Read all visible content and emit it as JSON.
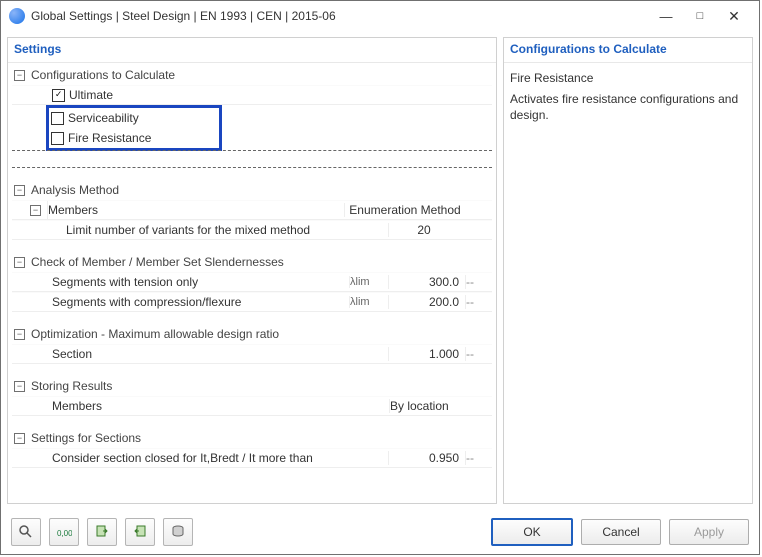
{
  "window": {
    "title": "Global Settings | Steel Design | EN 1993 | CEN | 2015-06"
  },
  "left": {
    "title": "Settings",
    "groups": {
      "config": {
        "title": "Configurations to Calculate",
        "items": {
          "ultimate": {
            "label": "Ultimate",
            "checked": true
          },
          "serviceability": {
            "label": "Serviceability",
            "checked": false
          },
          "fire": {
            "label": "Fire Resistance",
            "checked": false
          }
        }
      },
      "analysis": {
        "title": "Analysis Method",
        "members_label": "Members",
        "enum_header": "Enumeration Method",
        "mixed_label": "Limit number of variants for the mixed method",
        "mixed_value": "20"
      },
      "slenderness": {
        "title": "Check of Member / Member Set Slendernesses",
        "tension_label": "Segments with tension only",
        "tension_param": "λlim",
        "tension_value": "300.0",
        "tension_unit": "--",
        "flexure_label": "Segments with compression/flexure",
        "flexure_param": "λlim",
        "flexure_value": "200.0",
        "flexure_unit": "--"
      },
      "optimization": {
        "title": "Optimization - Maximum allowable design ratio",
        "section_label": "Section",
        "section_value": "1.000",
        "section_unit": "--"
      },
      "storing": {
        "title": "Storing Results",
        "members_label": "Members",
        "members_value": "By location"
      },
      "sections": {
        "title": "Settings for Sections",
        "closed_label": "Consider section closed for It,Bredt / It more than",
        "closed_value": "0.950",
        "closed_unit": "--"
      }
    }
  },
  "right": {
    "title": "Configurations to Calculate",
    "subhead": "Fire Resistance",
    "desc": "Activates fire resistance configurations and design."
  },
  "footer": {
    "ok": "OK",
    "cancel": "Cancel",
    "apply": "Apply"
  }
}
